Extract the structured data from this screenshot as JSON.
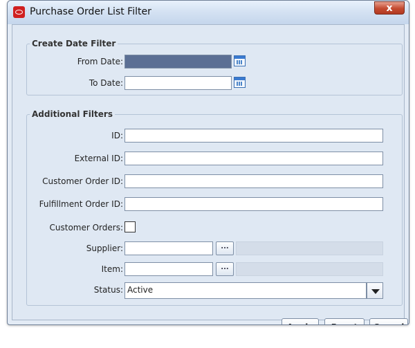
{
  "window": {
    "title": "Purchase Order List Filter",
    "close_glyph": "x"
  },
  "create_date_filter": {
    "legend": "Create Date Filter",
    "from_date": {
      "label": "From Date:",
      "value": ""
    },
    "to_date": {
      "label": "To Date:",
      "value": ""
    }
  },
  "additional_filters": {
    "legend": "Additional Filters",
    "id": {
      "label": "ID:",
      "value": ""
    },
    "external_id": {
      "label": "External ID:",
      "value": ""
    },
    "customer_order_id": {
      "label": "Customer Order ID:",
      "value": ""
    },
    "fulfillment_order_id": {
      "label": "Fulfillment Order ID:",
      "value": ""
    },
    "customer_orders": {
      "label": "Customer Orders:",
      "checked": false
    },
    "supplier": {
      "label": "Supplier:",
      "value": "",
      "browse": "..."
    },
    "item": {
      "label": "Item:",
      "value": "",
      "browse": "..."
    },
    "status": {
      "label": "Status:",
      "value": "Active"
    }
  },
  "buttons": {
    "apply": "Apply",
    "reset": "Reset",
    "cancel": "Cancel"
  },
  "colors": {
    "accent_selected": "#5b6f94",
    "oracle_red": "#d02020"
  }
}
